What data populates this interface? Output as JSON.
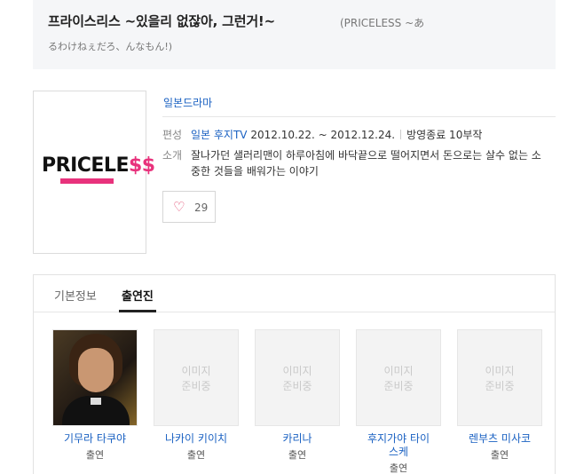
{
  "header": {
    "title": "프라이스리스 ~있을리 없잖아, 그런거!~",
    "original_title_line1": "(PRICELESS ~あ",
    "original_title_line2": "るわけねぇだろ、んなもん!)"
  },
  "poster": {
    "logo_text_a": "PRICELE",
    "logo_text_b": "$$"
  },
  "info": {
    "genre": "일본드라마",
    "broadcast_label": "편성",
    "broadcast_network": "일본 후지TV",
    "broadcast_period": "2012.10.22. ~ 2012.12.24.",
    "broadcast_status": "방영종료 10부작",
    "intro_label": "소개",
    "intro_text": "잘나가던 샐러리맨이 하루아침에 바닥끝으로 떨어지면서 돈으로는 살수 없는 소중한 것들을 배워가는 이야기"
  },
  "like": {
    "icon": "heart-outline-icon",
    "count": "29",
    "color": "#e0436b"
  },
  "tabs": [
    {
      "label": "기본정보",
      "active": false
    },
    {
      "label": "출연진",
      "active": true
    }
  ],
  "cast": [
    {
      "name": "기무라 타쿠야",
      "role": "출연",
      "has_photo": true
    },
    {
      "name": "나카이 키이치",
      "role": "출연",
      "placeholder": "이미지\n준비중"
    },
    {
      "name": "카리나",
      "role": "출연",
      "placeholder": "이미지\n준비중"
    },
    {
      "name": "후지가야 타이스케",
      "role": "출연",
      "placeholder": "이미지\n준비중"
    },
    {
      "name": "렌부츠 미사코",
      "role": "출연",
      "placeholder": "이미지\n준비중"
    }
  ],
  "colors": {
    "link": "#1a61c2",
    "header_bg": "#f5f6f8"
  }
}
